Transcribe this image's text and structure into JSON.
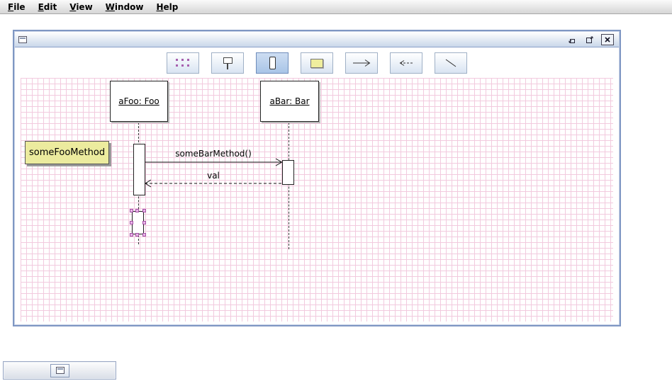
{
  "menu": {
    "items": [
      {
        "label": "File"
      },
      {
        "label": "Edit"
      },
      {
        "label": "View"
      },
      {
        "label": "Window"
      },
      {
        "label": "Help"
      }
    ]
  },
  "window": {
    "title": "",
    "controls": [
      "minimize-icon",
      "maximize-icon",
      "close-icon"
    ]
  },
  "toolbar": {
    "selected_tool": "activation-tool",
    "buttons": [
      {
        "name": "selection-tool",
        "icon": "selection-dots-icon"
      },
      {
        "name": "object-tool",
        "icon": "object-lifeline-icon"
      },
      {
        "name": "activation-tool",
        "icon": "activation-bar-icon"
      },
      {
        "name": "note-tool",
        "icon": "note-icon"
      },
      {
        "name": "call-arrow-tool",
        "icon": "arrow-right-icon"
      },
      {
        "name": "return-arrow-tool",
        "icon": "arrow-left-icon"
      },
      {
        "name": "line-tool",
        "icon": "diagonal-line-icon"
      }
    ]
  },
  "diagram": {
    "objects": [
      {
        "label": "aFoo: Foo"
      },
      {
        "label": "aBar: Bar"
      }
    ],
    "note": {
      "text": "someFooMethod"
    },
    "messages": [
      {
        "label": "someBarMethod()",
        "type": "call"
      },
      {
        "label": "val",
        "type": "return"
      }
    ]
  },
  "taskbar": {
    "minimized_frame_title": ""
  },
  "colors": {
    "grid": "#f2cade",
    "note_fill": "#eceb9e",
    "selection_handle": "#a44fa4",
    "frame_border": "#7f97c3",
    "toolbar_selected": "#a9c5e7"
  }
}
